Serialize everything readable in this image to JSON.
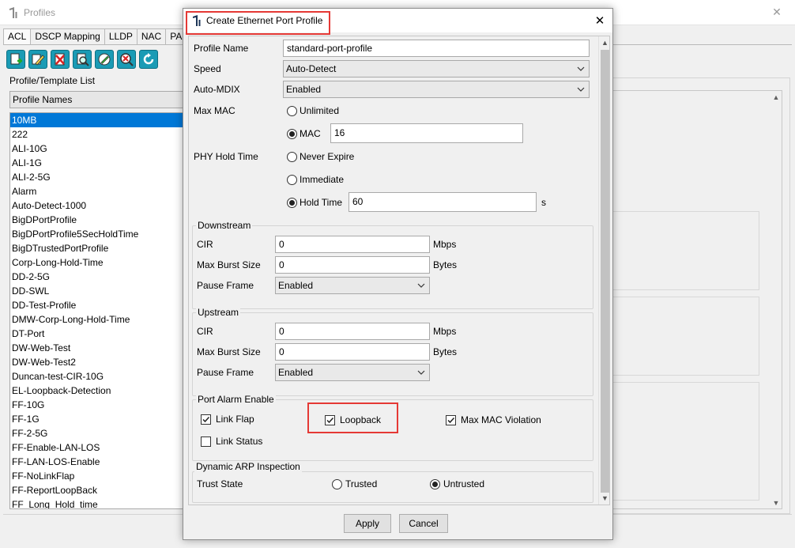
{
  "main_window": {
    "title": "Profiles",
    "tabs": [
      "ACL",
      "DSCP Mapping",
      "LLDP",
      "NAC",
      "PA"
    ],
    "toolbar_icons": [
      "add-profile-icon",
      "edit-profile-icon",
      "delete-profile-icon",
      "view-profile-icon",
      "edit-template-icon",
      "view-template-icon",
      "refresh-icon"
    ],
    "list_title": "Profile/Template List",
    "list_header": "Profile Names",
    "profiles": [
      "10MB",
      "222",
      "ALI-10G",
      "ALI-1G",
      "ALI-2-5G",
      "Alarm",
      "Auto-Detect-1000",
      "BigDPortProfile",
      "BigDPortProfile5SecHoldTime",
      "BigDTrustedPortProfile",
      "Corp-Long-Hold-Time",
      "DD-2-5G",
      "DD-SWL",
      "DD-Test-Profile",
      "DMW-Corp-Long-Hold-Time",
      "DT-Port",
      "DW-Web-Test",
      "DW-Web-Test2",
      "Duncan-test-CIR-10G",
      "EL-Loopback-Detection",
      "FF-10G",
      "FF-1G",
      "FF-2-5G",
      "FF-Enable-LAN-LOS",
      "FF-LAN-LOS-Enable",
      "FF-NoLinkFlap",
      "FF-ReportLoopBack",
      "FF_Long_Hold_time"
    ],
    "selected_index": 0
  },
  "dialog": {
    "title": "Create Ethernet Port Profile",
    "profile_name_label": "Profile Name",
    "profile_name_value": "standard-port-profile",
    "speed_label": "Speed",
    "speed_value": "Auto-Detect",
    "auto_mdix_label": "Auto-MDIX",
    "auto_mdix_value": "Enabled",
    "max_mac_label": "Max MAC",
    "max_mac_unlimited": "Unlimited",
    "max_mac_mac": "MAC",
    "max_mac_value": "16",
    "phy_hold_label": "PHY Hold Time",
    "phy_never_expire": "Never Expire",
    "phy_immediate": "Immediate",
    "phy_hold_time": "Hold Time",
    "phy_hold_value": "60",
    "phy_hold_unit": "s",
    "downstream": {
      "title": "Downstream",
      "cir_label": "CIR",
      "cir_value": "0",
      "cir_unit": "Mbps",
      "burst_label": "Max Burst Size",
      "burst_value": "0",
      "burst_unit": "Bytes",
      "pause_label": "Pause Frame",
      "pause_value": "Enabled"
    },
    "upstream": {
      "title": "Upstream",
      "cir_label": "CIR",
      "cir_value": "0",
      "cir_unit": "Mbps",
      "burst_label": "Max Burst Size",
      "burst_value": "0",
      "burst_unit": "Bytes",
      "pause_label": "Pause Frame",
      "pause_value": "Enabled"
    },
    "alarm": {
      "title": "Port Alarm Enable",
      "link_flap": "Link Flap",
      "loopback": "Loopback",
      "max_mac_violation": "Max MAC Violation",
      "link_status": "Link Status"
    },
    "arp": {
      "title": "Dynamic ARP Inspection",
      "trust_state_label": "Trust State",
      "trusted": "Trusted",
      "untrusted": "Untrusted"
    },
    "apply_label": "Apply",
    "cancel_label": "Cancel"
  },
  "colors": {
    "selection": "#0078d7",
    "toolbar_button": "#1a9bb5",
    "highlight_box": "#e53935"
  }
}
